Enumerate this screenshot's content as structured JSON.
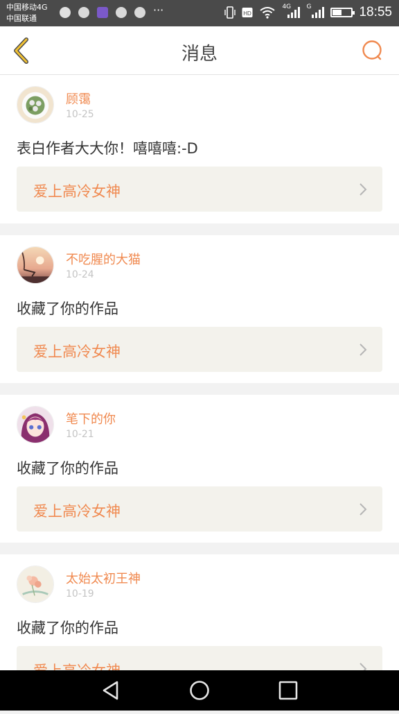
{
  "status_bar": {
    "carrier_line1": "中国移动4G",
    "carrier_line2": "中国联通",
    "net1": "4G",
    "net2": "G",
    "battery_level": 0.45,
    "time": "18:55"
  },
  "nav": {
    "title": "消息",
    "back_icon": "chevron-left-icon",
    "search_icon": "search-icon"
  },
  "messages": [
    {
      "user": "顾霭",
      "date": "10-25",
      "text": "表白作者大大你！嘻嘻嘻:-D",
      "work": "爱上高冷女神",
      "avatar": "avatar-food-plate"
    },
    {
      "user": "不吃腥的大猫",
      "date": "10-24",
      "text": "收藏了你的作品",
      "work": "爱上高冷女神",
      "avatar": "avatar-sunset-swing"
    },
    {
      "user": "笔下的你",
      "date": "10-21",
      "text": "收藏了你的作品",
      "work": "爱上高冷女神",
      "avatar": "avatar-anime-girl"
    },
    {
      "user": "太始太初王神",
      "date": "10-19",
      "text": "收藏了你的作品",
      "work": "爱上高冷女神",
      "avatar": "avatar-flower-painting"
    }
  ],
  "colors": {
    "accent": "#f0894f",
    "back_icon": "#f2c233",
    "card_link_bg": "#f3f2ec"
  },
  "system_nav": [
    "back-icon",
    "home-icon",
    "recents-icon"
  ]
}
